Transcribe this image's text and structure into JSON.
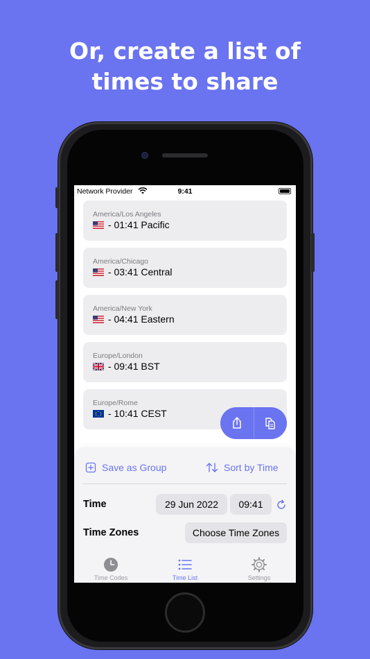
{
  "headline": {
    "line1": "Or, create a list of",
    "line2": "times to share"
  },
  "status_bar": {
    "carrier": "Network Provider",
    "time": "9:41"
  },
  "time_list": [
    {
      "zone": "America/Los Angeles",
      "flag": "us",
      "time_text": " - 01:41 Pacific"
    },
    {
      "zone": "America/Chicago",
      "flag": "us",
      "time_text": " - 03:41 Central"
    },
    {
      "zone": "America/New York",
      "flag": "us",
      "time_text": " - 04:41 Eastern"
    },
    {
      "zone": "Europe/London",
      "flag": "gb",
      "time_text": " - 09:41 BST"
    },
    {
      "zone": "Europe/Rome",
      "flag": "eu",
      "time_text": " - 10:41 CEST"
    }
  ],
  "floating_actions": {
    "share_icon": "share-icon",
    "copy_icon": "copy-icon"
  },
  "panel": {
    "save_group_label": "Save as Group",
    "sort_label": "Sort by Time",
    "time_label": "Time",
    "date_value": "29 Jun 2022",
    "time_value": "09:41",
    "time_zones_label": "Time Zones",
    "choose_zones_label": "Choose Time Zones"
  },
  "tabs": [
    {
      "label": "Time Codes",
      "icon": "clock-icon",
      "active": false
    },
    {
      "label": "Time List",
      "icon": "list-icon",
      "active": true
    },
    {
      "label": "Settings",
      "icon": "gear-icon",
      "active": false
    }
  ],
  "colors": {
    "accent": "#6a73f0",
    "background": "#6a73f0",
    "card": "#ededf0",
    "panel": "#f4f4f7"
  }
}
